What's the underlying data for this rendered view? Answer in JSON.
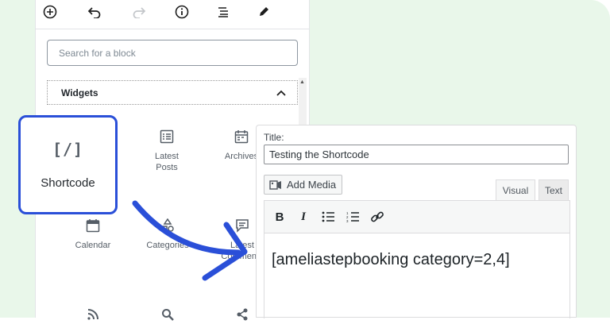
{
  "inserter": {
    "search": {
      "placeholder": "Search for a block",
      "value": ""
    },
    "panel": {
      "title": "Widgets"
    },
    "blocks": [
      {
        "label": "Latest\nPosts",
        "icon": "latest-posts-icon"
      },
      {
        "label": "Archives",
        "icon": "archives-icon"
      },
      {
        "label": "Calendar",
        "icon": "calendar-icon"
      },
      {
        "label": "Categories",
        "icon": "categories-icon"
      },
      {
        "label": "Latest\nComments",
        "icon": "comments-icon"
      }
    ],
    "highlighted_block": {
      "label": "Shortcode",
      "icon_text": "[/]"
    }
  },
  "editor": {
    "title_label": "Title:",
    "title_value": "Testing the Shortcode",
    "add_media_label": "Add Media",
    "tabs": {
      "visual": "Visual",
      "text": "Text"
    },
    "content": "[ameliastepbooking category=2,4]"
  },
  "colors": {
    "background": "#e9f7ea",
    "highlight_border": "#2a4fd8",
    "arrow": "#2a4fd8"
  }
}
